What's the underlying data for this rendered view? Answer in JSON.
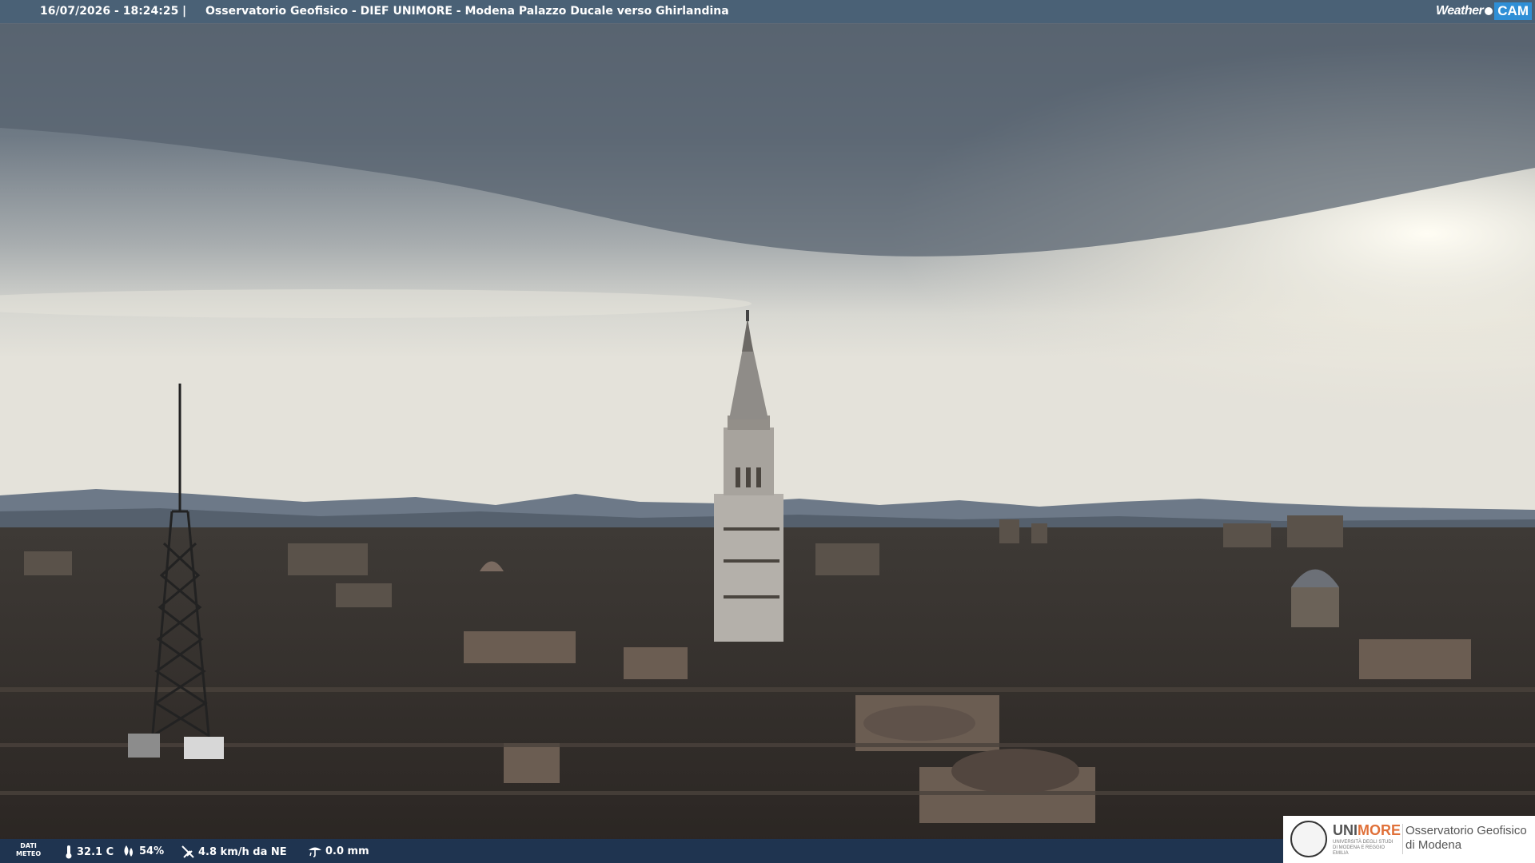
{
  "header": {
    "timestamp": "16/07/2026 - 18:24:25",
    "separator": "|",
    "title": "Osservatorio Geofisico - DIEF UNIMORE - Modena Palazzo Ducale verso Ghirlandina",
    "brand_weather": "Weather",
    "brand_cam": "CAM"
  },
  "weather": {
    "label_line1": "DATI",
    "label_line2": "METEO",
    "temperature": "32.1 C",
    "humidity": "54%",
    "wind": "4.8 km/h da NE",
    "rain": "0.0 mm",
    "icons": [
      "thermometer-icon",
      "humidity-drop-icon",
      "wind-icon",
      "rain-gauge-icon"
    ]
  },
  "logo": {
    "uni_prefix": "UNI",
    "uni_suffix": "MORE",
    "uni_sub": "UNIVERSITÀ DEGLI STUDI DI MODENA E REGGIO EMILIA",
    "obs_line1": "Osservatorio Geofisico",
    "obs_line2": "di Modena"
  },
  "colors": {
    "topbar": "#4a6176",
    "bottombar": "#1c3a60",
    "brand_cam": "#2f8fd6",
    "unimore_accent": "#e0713a"
  }
}
